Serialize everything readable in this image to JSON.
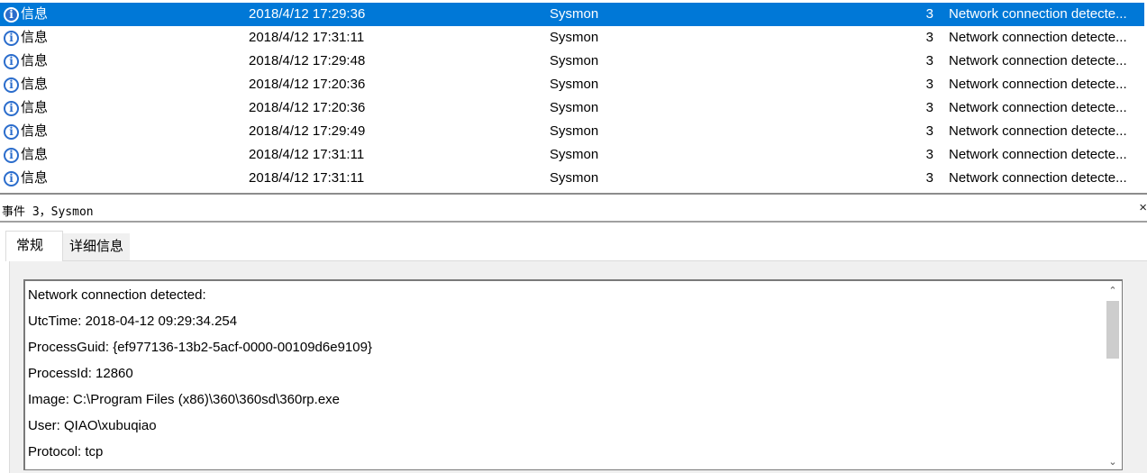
{
  "events": [
    {
      "level": "信息",
      "date": "2018/4/12 17:29:36",
      "source": "Sysmon",
      "event_id": "3",
      "task": "Network connection detecte...",
      "selected": true
    },
    {
      "level": "信息",
      "date": "2018/4/12 17:31:11",
      "source": "Sysmon",
      "event_id": "3",
      "task": "Network connection detecte...",
      "selected": false
    },
    {
      "level": "信息",
      "date": "2018/4/12 17:29:48",
      "source": "Sysmon",
      "event_id": "3",
      "task": "Network connection detecte...",
      "selected": false
    },
    {
      "level": "信息",
      "date": "2018/4/12 17:20:36",
      "source": "Sysmon",
      "event_id": "3",
      "task": "Network connection detecte...",
      "selected": false
    },
    {
      "level": "信息",
      "date": "2018/4/12 17:20:36",
      "source": "Sysmon",
      "event_id": "3",
      "task": "Network connection detecte...",
      "selected": false
    },
    {
      "level": "信息",
      "date": "2018/4/12 17:29:49",
      "source": "Sysmon",
      "event_id": "3",
      "task": "Network connection detecte...",
      "selected": false
    },
    {
      "level": "信息",
      "date": "2018/4/12 17:31:11",
      "source": "Sysmon",
      "event_id": "3",
      "task": "Network connection detecte...",
      "selected": false
    },
    {
      "level": "信息",
      "date": "2018/4/12 17:31:11",
      "source": "Sysmon",
      "event_id": "3",
      "task": "Network connection detecte...",
      "selected": false
    }
  ],
  "detail": {
    "title": "事件 3，Sysmon",
    "close_glyph": "×",
    "tabs": {
      "general": "常规",
      "details": "详细信息"
    },
    "description_lines": [
      "Network connection detected:",
      "UtcTime: 2018-04-12 09:29:34.254",
      "ProcessGuid: {ef977136-13b2-5acf-0000-00109d6e9109}",
      "ProcessId: 12860",
      "Image: C:\\Program Files (x86)\\360\\360sd\\360rp.exe",
      "User: QIAO\\xubuqiao",
      "Protocol: tcp"
    ],
    "scroll_up_glyph": "⌃",
    "scroll_down_glyph": "⌄"
  },
  "colors": {
    "selection": "#0078d7",
    "info_icon": "#2b6dcc",
    "panel_bg": "#f0f0f0"
  },
  "icons": {
    "level": "info-icon"
  }
}
